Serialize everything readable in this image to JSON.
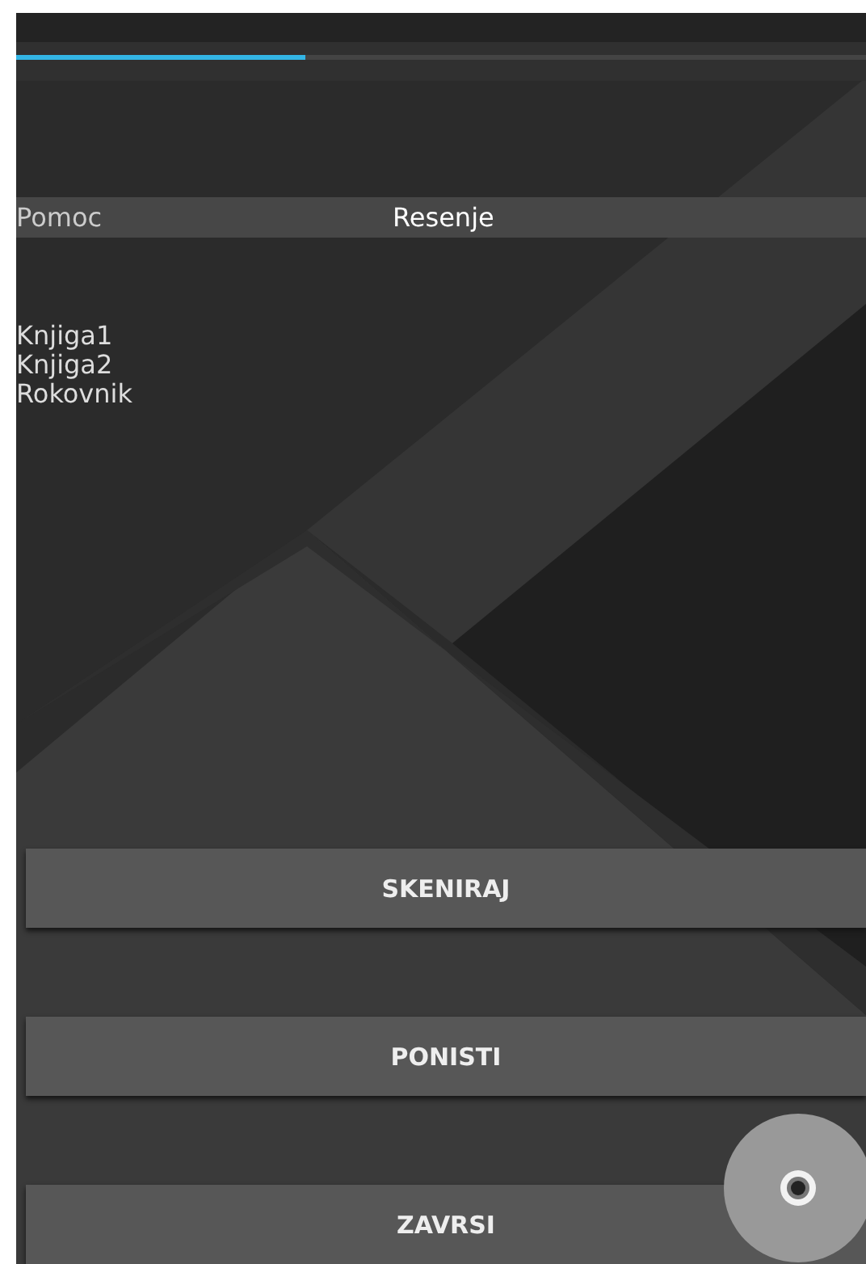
{
  "progress": {
    "level": 0.34
  },
  "header": {
    "left": "Pomoc",
    "center": "Resenje"
  },
  "items": [
    "Knjiga1",
    "Knjiga2",
    "Rokovnik"
  ],
  "buttons": [
    {
      "label": "SKENIRAJ"
    },
    {
      "label": "PONISTI"
    },
    {
      "label": "ZAVRSI"
    }
  ],
  "fab": {
    "kind": "camera"
  }
}
